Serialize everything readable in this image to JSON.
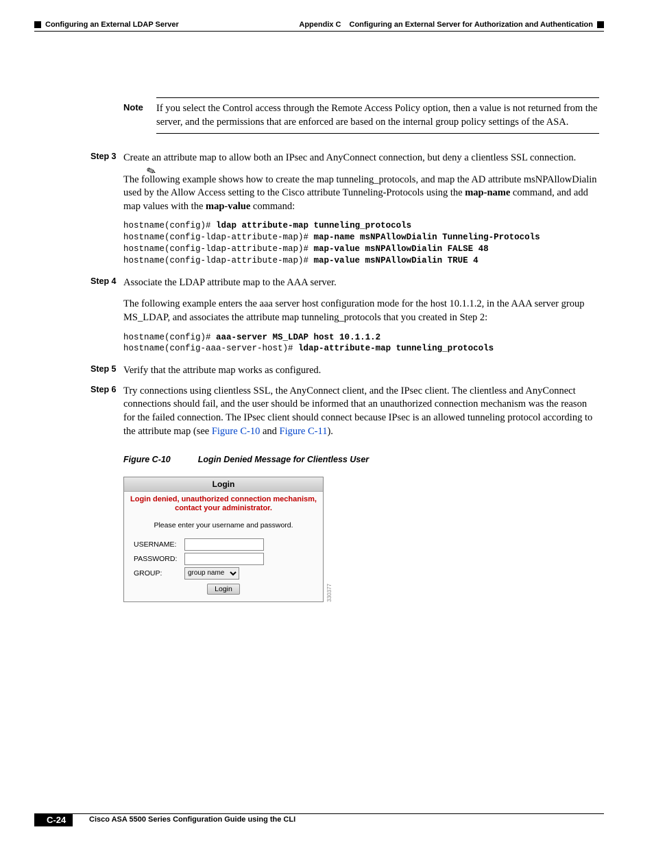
{
  "header": {
    "left": "Configuring an External LDAP Server",
    "appendix": "Appendix C",
    "right": "Configuring an External Server for Authorization and Authentication"
  },
  "note": {
    "label": "Note",
    "text": "If you select the Control access through the Remote Access Policy option, then a value is not returned from the server, and the permissions that are enforced are based on the internal group policy settings of the ASA."
  },
  "step3": {
    "label": "Step 3",
    "intro": "Create an attribute map to allow both an IPsec and AnyConnect connection, but deny a clientless SSL connection.",
    "para_pre": "The following example shows how to create the map tunneling_protocols, and map the AD attribute msNPAllowDialin used by the Allow Access setting to the Cisco attribute Tunneling-Protocols using the ",
    "mapname": "map-name",
    "para_mid": " command, and add map values with the ",
    "mapvalue": "map-value",
    "para_post": " command:",
    "code": {
      "l1p": "hostname(config)# ",
      "l1b": "ldap attribute-map tunneling_protocols",
      "l2p": "hostname(config-ldap-attribute-map)# ",
      "l2b": "map-name msNPAllowDialin Tunneling-Protocols",
      "l3p": "hostname(config-ldap-attribute-map)# ",
      "l3b": "map-value msNPAllowDialin FALSE 48",
      "l4p": "hostname(config-ldap-attribute-map)# ",
      "l4b": "map-value msNPAllowDialin TRUE 4"
    }
  },
  "step4": {
    "label": "Step 4",
    "intro": "Associate the LDAP attribute map to the AAA server.",
    "para": "The following example enters the aaa server host configuration mode for the host 10.1.1.2, in the AAA server group MS_LDAP, and associates the attribute map tunneling_protocols that you created in Step 2:",
    "code": {
      "l1p": "hostname(config)# ",
      "l1b": "aaa-server MS_LDAP host 10.1.1.2",
      "l2p": "hostname(config-aaa-server-host)# ",
      "l2b": "ldap-attribute-map tunneling_protocols"
    }
  },
  "step5": {
    "label": "Step 5",
    "intro": "Verify that the attribute map works as configured."
  },
  "step6": {
    "label": "Step 6",
    "text_pre": "Try connections using clientless SSL, the AnyConnect client, and the IPsec client. The clientless and AnyConnect connections should fail, and the user should be informed that an unauthorized connection mechanism was the reason for the failed connection. The IPsec client should connect because IPsec is an allowed tunneling protocol according to the attribute map (see ",
    "link1": "Figure C-10",
    "text_mid": " and ",
    "link2": "Figure C-11",
    "text_post": ")."
  },
  "figure": {
    "num": "Figure C-10",
    "title": "Login Denied Message for Clientless User",
    "id": "330377"
  },
  "login": {
    "title": "Login",
    "error": "Login denied, unauthorized connection mechanism, contact your administrator.",
    "msg": "Please enter your username and password.",
    "username_label": "USERNAME:",
    "password_label": "PASSWORD:",
    "group_label": "GROUP:",
    "group_value": "group name",
    "button": "Login"
  },
  "footer": {
    "title": "Cisco ASA 5500 Series Configuration Guide using the CLI",
    "page": "C-24"
  }
}
